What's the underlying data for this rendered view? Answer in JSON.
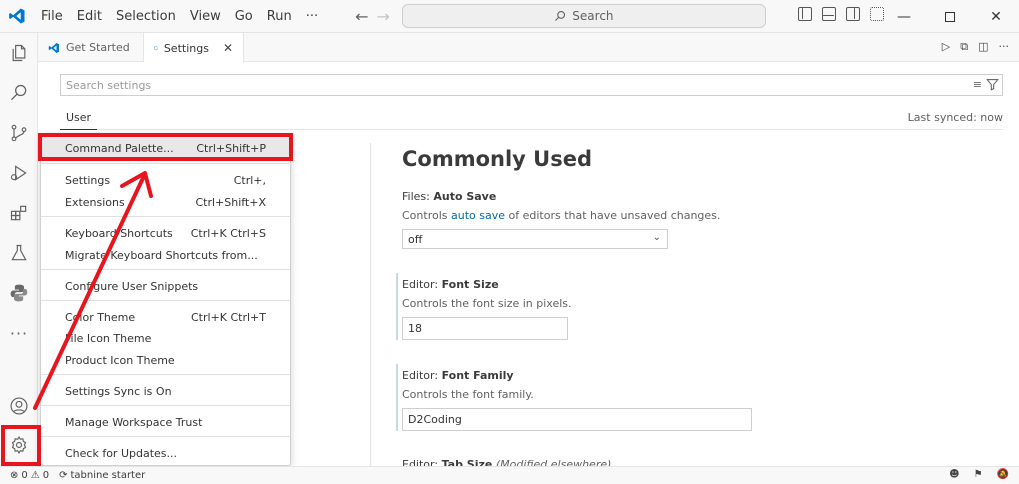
{
  "titlebar": {
    "menu": [
      "File",
      "Edit",
      "Selection",
      "View",
      "Go",
      "Run",
      "···"
    ],
    "search_label": "Search"
  },
  "tabs": [
    {
      "label": "Get Started",
      "active": false
    },
    {
      "label": "Settings",
      "active": true
    }
  ],
  "settings": {
    "search_placeholder": "Search settings",
    "scope_tab": "User",
    "last_synced": "Last synced: now",
    "heading": "Commonly Used",
    "items": [
      {
        "category": "Files: ",
        "name": "Auto Save",
        "description_before": "Controls ",
        "description_link": "auto save",
        "description_after": " of editors that have unsaved changes.",
        "value": "off"
      },
      {
        "category": "Editor: ",
        "name": "Font Size",
        "description": "Controls the font size in pixels.",
        "value": "18"
      },
      {
        "category": "Editor: ",
        "name": "Font Family",
        "description": "Controls the font family.",
        "value": "D2Coding"
      },
      {
        "category": "Editor: ",
        "name": "Tab Size",
        "note": "(Modified elsewhere)"
      }
    ]
  },
  "context_menu": {
    "items": [
      {
        "label": "Command Palette...",
        "shortcut": "Ctrl+Shift+P"
      },
      {
        "label": "Settings",
        "shortcut": "Ctrl+,"
      },
      {
        "label": "Extensions",
        "shortcut": "Ctrl+Shift+X"
      },
      {
        "label": "Keyboard Shortcuts",
        "shortcut": "Ctrl+K Ctrl+S"
      },
      {
        "label": "Migrate Keyboard Shortcuts from...",
        "shortcut": ""
      },
      {
        "label": "Configure User Snippets",
        "shortcut": ""
      },
      {
        "label": "Color Theme",
        "shortcut": "Ctrl+K Ctrl+T"
      },
      {
        "label": "File Icon Theme",
        "shortcut": ""
      },
      {
        "label": "Product Icon Theme",
        "shortcut": ""
      },
      {
        "label": "Settings Sync is On",
        "shortcut": ""
      },
      {
        "label": "Manage Workspace Trust",
        "shortcut": ""
      },
      {
        "label": "Check for Updates...",
        "shortcut": ""
      }
    ]
  },
  "statusbar": {
    "errors": "0",
    "warnings": "0",
    "extension": "tabnine starter"
  },
  "colors": {
    "accent_blue": "#0065a9",
    "annotation_red": "#e8141e",
    "link": "#006ab1"
  },
  "icons": {
    "activity_bar": [
      "explorer-icon",
      "search-icon",
      "source-control-icon",
      "run-debug-icon",
      "extensions-icon",
      "testing-icon",
      "python-icon",
      "more-icon",
      "accounts-icon",
      "manage-gear-icon"
    ]
  }
}
